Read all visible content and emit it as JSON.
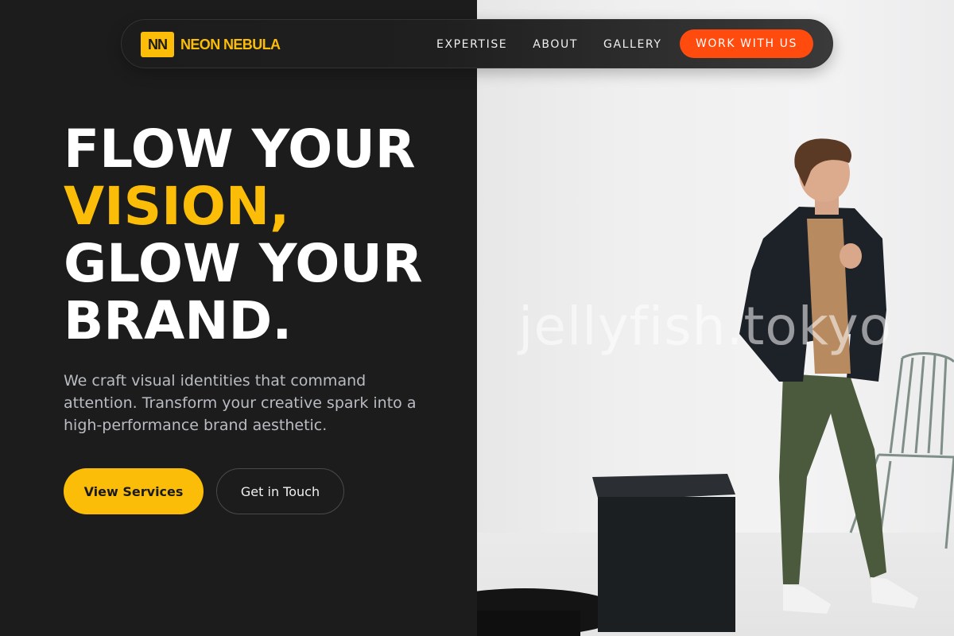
{
  "brand": {
    "logo_text": "NN",
    "name": "NEON NEBULA"
  },
  "nav": {
    "links": [
      "EXPERTISE",
      "ABOUT",
      "GALLERY"
    ],
    "cta": "WORK WITH US"
  },
  "hero": {
    "line1": "FLOW YOUR",
    "line2": "VISION,",
    "line3": "GLOW YOUR",
    "line4": "BRAND.",
    "subtitle": "We craft visual identities that command attention. Transform your creative spark into a high-performance brand aesthetic.",
    "primary_button": "View Services",
    "secondary_button": "Get in Touch"
  },
  "photo": {
    "watermark": "jellyfish.tokyo"
  },
  "colors": {
    "accent": "#fbbd08",
    "cta": "#ff4b0e",
    "background": "#1c1c1c"
  }
}
